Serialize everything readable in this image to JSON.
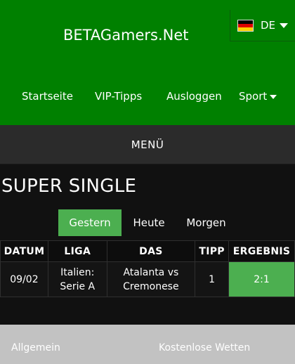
{
  "header": {
    "brand": "BETAGamers.Net",
    "language": {
      "code": "DE",
      "flag_colors": [
        "#000000",
        "#dd0000",
        "#ffce00"
      ]
    },
    "nav": [
      {
        "label": "Startseite"
      },
      {
        "label": "VIP-Tipps"
      },
      {
        "label": "Ausloggen"
      },
      {
        "label": "Sport",
        "dropdown": true
      }
    ],
    "bg_color": "#008000"
  },
  "menu": {
    "label": "MENÜ"
  },
  "main": {
    "title": "SUPER SINGLE",
    "tabs": [
      {
        "label": "Gestern",
        "active": true
      },
      {
        "label": "Heute",
        "active": false
      },
      {
        "label": "Morgen",
        "active": false
      }
    ],
    "accent_color": "#4caf50",
    "table": {
      "headers": [
        "DATUM",
        "LIGA",
        "DAS",
        "TIPP",
        "ERGEBNIS"
      ],
      "rows": [
        {
          "datum": "09/02",
          "liga": "Italien: Serie A",
          "das": "Atalanta vs Cremonese",
          "tipp": "1",
          "ergebnis": "2:1"
        }
      ]
    }
  },
  "footer": {
    "links": [
      "Allgemein",
      "Kostenlose Wetten"
    ]
  }
}
